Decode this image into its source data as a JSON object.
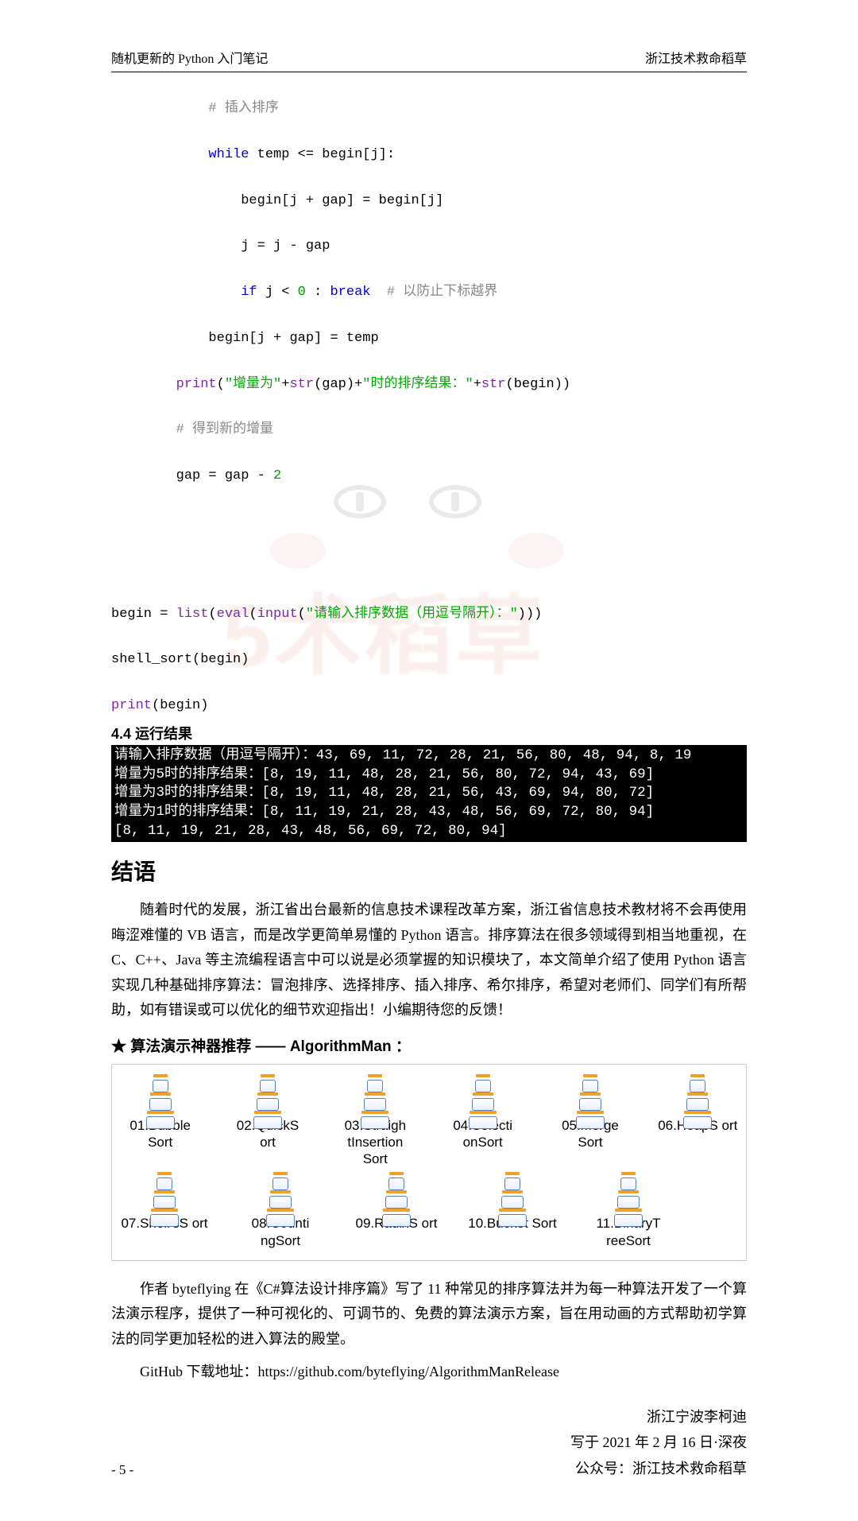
{
  "header": {
    "left": "随机更新的 Python 入门笔记",
    "right": "浙江技术救命稻草"
  },
  "code": {
    "l1_cmt": "# 插入排序",
    "l2_kw": "while",
    "l2_rest1": " temp ",
    "l2_op": "<=",
    "l2_rest2": " begin[j]:",
    "l3": "begin[j + gap] = begin[j]",
    "l4": "j = j - gap",
    "l5_kw": "if",
    "l5_var": " j ",
    "l5_op": "<",
    "l5_zero": " 0 ",
    "l5_colon": ": ",
    "l5_break": "break",
    "l5_cmt": "  # 以防止下标越界",
    "l6": "begin[j + gap] = temp",
    "l7_fn": "print",
    "l7_s1": "\"增量为\"",
    "l7_plus1": "+",
    "l7_str1": "str",
    "l7_g": "(gap)",
    "l7_plus2": "+",
    "l7_s2": "\"时的排序结果：\"",
    "l7_plus3": "+",
    "l7_str2": "str",
    "l7_b": "(begin))",
    "l8_cmt": "# 得到新的增量",
    "l9a": "gap = gap ",
    "l9op": "-",
    "l9two": " 2",
    "l10_a": "begin = ",
    "l10_list": "list",
    "l10_p1": "(",
    "l10_eval": "eval",
    "l10_p2": "(",
    "l10_input": "input",
    "l10_p3": "(",
    "l10_str": "\"请输入排序数据（用逗号隔开）：\"",
    "l10_p4": ")))",
    "l11": "shell_sort(begin)",
    "l12_fn": "print",
    "l12_arg": "(begin)"
  },
  "section_heading": "4.4 运行结果",
  "terminal": {
    "l1": "请输入排序数据（用逗号隔开）：43, 69, 11, 72, 28, 21, 56, 80, 48, 94, 8, 19",
    "l2": "增量为5时的排序结果：[8, 19, 11, 48, 28, 21, 56, 80, 72, 94, 43, 69]",
    "l3": "增量为3时的排序结果：[8, 19, 11, 48, 28, 21, 56, 43, 69, 94, 80, 72]",
    "l4": "增量为1时的排序结果：[8, 11, 19, 21, 28, 43, 48, 56, 69, 72, 80, 94]",
    "l5": "[8, 11, 19, 21, 28, 43, 48, 56, 69, 72, 80, 94]"
  },
  "closing_heading": "结语",
  "body1": "随着时代的发展，浙江省出台最新的信息技术课程改革方案，浙江省信息技术教材将不会再使用晦涩难懂的 VB 语言，而是改学更简单易懂的 Python 语言。排序算法在很多领域得到相当地重视，在 C、C++、Java 等主流编程语言中可以说是必须掌握的知识模块了，本文简单介绍了使用 Python 语言实现几种基础排序算法：冒泡排序、选择排序、插入排序、希尔排序，希望对老师们、同学们有所帮助，如有错误或可以优化的细节欢迎指出！小编期待您的反馈！",
  "star_line": "★ 算法演示神器推荐 —— AlgorithmMan ：",
  "algos": {
    "row1": [
      "01.Bubble Sort",
      "02.QuickS ort",
      "03.Straigh tInsertion Sort",
      "04.Selecti onSort",
      "05.Merge Sort",
      "06.HeapS ort"
    ],
    "row2": [
      "07.Shell'sS ort",
      "08.Counti ngSort",
      "09.RadixS ort",
      "10.Bucket Sort",
      "11.BinaryT reeSort"
    ]
  },
  "body2": "作者 byteflying 在《C#算法设计排序篇》写了 11 种常见的排序算法并为每一种算法开发了一个算法演示程序，提供了一种可视化的、可调节的、免费的算法演示方案，旨在用动画的方式帮助初学算法的同学更加轻松的进入算法的殿堂。",
  "github_line": "GitHub 下载地址：https://github.com/byteflying/AlgorithmManRelease",
  "signature": {
    "l1": "浙江宁波李柯迪",
    "l2": "写于 2021 年 2 月 16 日·深夜",
    "l3": "公众号：浙江技术救命稻草"
  },
  "pagenum": "- 5 -"
}
